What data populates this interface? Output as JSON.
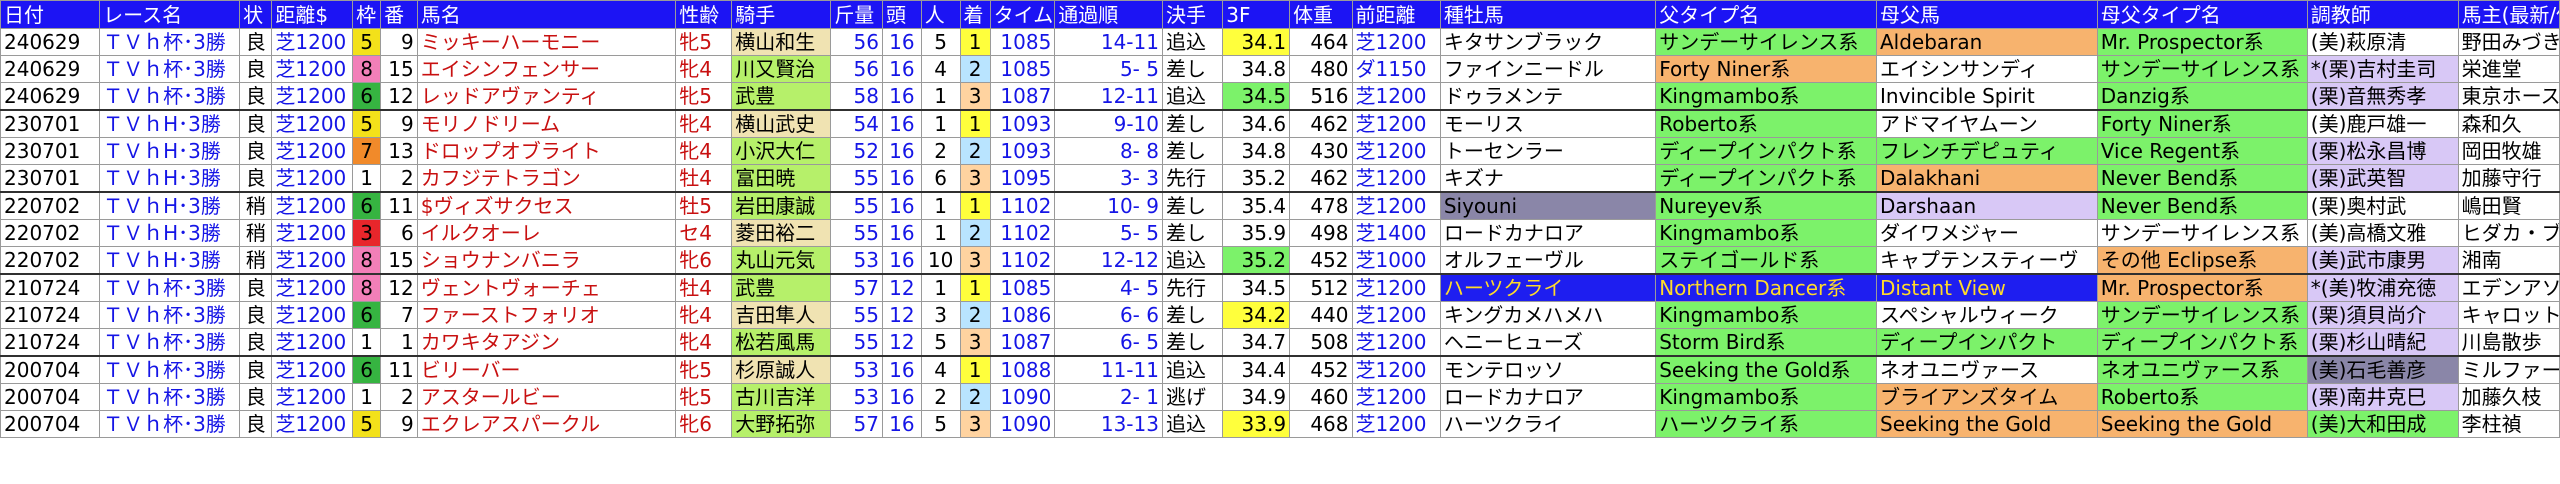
{
  "columns": [
    "日付",
    "レース名",
    "状",
    "距離$",
    "枠",
    "番",
    "馬名",
    "性齢",
    "騎手",
    "斤量",
    "頭",
    "人",
    "着",
    "タイム",
    "通過順",
    "決手",
    "3F",
    "体重",
    "前距離",
    "種牡馬",
    "父タイプ名",
    "母父馬",
    "母父タイプ名",
    "調教師",
    "馬主(最新/仮"
  ],
  "colors": {
    "header_bg": "#1c14f4",
    "frame1": "#ffffff",
    "frame2": "#222222",
    "frame3": "#e8262b",
    "frame4": "#2c62d6",
    "frame5": "#f3e11a",
    "frame6": "#36b441",
    "frame7": "#f18a2a",
    "frame8": "#f27fb8",
    "fast3f": "#ffff3c",
    "lime": "#7cf26a",
    "purple": "#d8c8f6",
    "jockey_green": "#b6f06a",
    "jockey_tan": "#f0e3b2",
    "orange": "#f7b36e",
    "navy": "#1e1ef0"
  },
  "rows": [
    {
      "date": "240629",
      "race": "ＴＶｈ杯･3勝",
      "cond": "良",
      "dist": "芝1200",
      "frame": "5",
      "no": "9",
      "horse": "ミッキーハーモニー",
      "sex": "牝5",
      "jockey": "横山和生",
      "kin": "56",
      "heads": "16",
      "pop": "5",
      "place": "1",
      "time": "1085",
      "pass": "14-11",
      "kimete": "追込",
      "f3": "34.1",
      "weight": "464",
      "prev": "芝1200",
      "sire": "キタサンブラック",
      "ftype": "サンデーサイレンス系",
      "damsire": "Aldebaran",
      "dstype": "Mr. Prospector系",
      "trainer": "(美)萩原清",
      "owner": "野田みづき",
      "bg": {
        "jockey": "#f0e3b2",
        "f3": "#ffff3c",
        "sire": "#ffffff",
        "ftype": "#7cf26a",
        "damsire": "#f7b36e",
        "dstype": "#7cf26a",
        "trainer": "#ffffff"
      }
    },
    {
      "date": "240629",
      "race": "ＴＶｈ杯･3勝",
      "cond": "良",
      "dist": "芝1200",
      "frame": "8",
      "no": "15",
      "horse": "エイシンフェンサー",
      "sex": "牝4",
      "jockey": "川又賢治",
      "kin": "56",
      "heads": "16",
      "pop": "4",
      "place": "2",
      "time": "1085",
      "pass": "5- 5",
      "kimete": "差し",
      "f3": "34.8",
      "weight": "480",
      "prev": "ダ1150",
      "sire": "ファインニードル",
      "ftype": "Forty Niner系",
      "damsire": "エイシンサンディ",
      "dstype": "サンデーサイレンス系",
      "trainer": "*(栗)吉村圭司",
      "owner": "栄進堂",
      "bg": {
        "jockey": "#b6f06a",
        "f3": "#ffffff",
        "sire": "#ffffff",
        "ftype": "#f7b36e",
        "damsire": "#ffffff",
        "dstype": "#7cf26a",
        "trainer": "#d8c8f6"
      }
    },
    {
      "date": "240629",
      "race": "ＴＶｈ杯･3勝",
      "cond": "良",
      "dist": "芝1200",
      "frame": "6",
      "no": "12",
      "horse": "レッドアヴァンティ",
      "sex": "牝5",
      "jockey": "武豊",
      "kin": "58",
      "heads": "16",
      "pop": "1",
      "place": "3",
      "time": "1087",
      "pass": "12-11",
      "kimete": "追込",
      "f3": "34.5",
      "weight": "516",
      "prev": "芝1200",
      "sire": "ドゥラメンテ",
      "ftype": "Kingmambo系",
      "damsire": "Invincible Spirit",
      "dstype": "Danzig系",
      "trainer": "(栗)音無秀孝",
      "owner": "東京ホースレー",
      "bg": {
        "jockey": "#b6f06a",
        "f3": "#7cf26a",
        "sire": "#ffffff",
        "ftype": "#7cf26a",
        "damsire": "#ffffff",
        "dstype": "#7cf26a",
        "trainer": "#d8c8f6"
      }
    },
    {
      "date": "230701",
      "race": "ＴＶｈH･3勝",
      "cond": "良",
      "dist": "芝1200",
      "frame": "5",
      "no": "9",
      "horse": "モリノドリーム",
      "sex": "牝4",
      "jockey": "横山武史",
      "kin": "54",
      "heads": "16",
      "pop": "1",
      "place": "1",
      "time": "1093",
      "pass": "9-10",
      "kimete": "差し",
      "f3": "34.6",
      "weight": "462",
      "prev": "芝1200",
      "sire": "モーリス",
      "ftype": "Roberto系",
      "damsire": "アドマイヤムーン",
      "dstype": "Forty Niner系",
      "trainer": "(美)鹿戸雄一",
      "owner": "森和久",
      "bg": {
        "jockey": "#f0e3b2",
        "f3": "#ffffff",
        "sire": "#ffffff",
        "ftype": "#7cf26a",
        "damsire": "#ffffff",
        "dstype": "#7cf26a",
        "trainer": "#ffffff"
      }
    },
    {
      "date": "230701",
      "race": "ＴＶｈH･3勝",
      "cond": "良",
      "dist": "芝1200",
      "frame": "7",
      "no": "13",
      "horse": "ドロップオブライト",
      "sex": "牝4",
      "jockey": "小沢大仁",
      "kin": "52",
      "heads": "16",
      "pop": "2",
      "place": "2",
      "time": "1093",
      "pass": "8- 8",
      "kimete": "差し",
      "f3": "34.8",
      "weight": "430",
      "prev": "芝1200",
      "sire": "トーセンラー",
      "ftype": "ディープインパクト系",
      "damsire": "フレンチデピュティ",
      "dstype": "Vice Regent系",
      "trainer": "(栗)松永昌博",
      "owner": "岡田牧雄",
      "bg": {
        "jockey": "#b6f06a",
        "f3": "#ffffff",
        "sire": "#ffffff",
        "ftype": "#7cf26a",
        "damsire": "#7cf26a",
        "dstype": "#7cf26a",
        "trainer": "#d8c8f6"
      }
    },
    {
      "date": "230701",
      "race": "ＴＶｈH･3勝",
      "cond": "良",
      "dist": "芝1200",
      "frame": "1",
      "no": "2",
      "horse": "カフジテトラゴン",
      "sex": "牡4",
      "jockey": "富田暁",
      "kin": "55",
      "heads": "16",
      "pop": "6",
      "place": "3",
      "time": "1095",
      "pass": "3- 3",
      "kimete": "先行",
      "f3": "35.2",
      "weight": "462",
      "prev": "芝1200",
      "sire": "キズナ",
      "ftype": "ディープインパクト系",
      "damsire": "Dalakhani",
      "dstype": "Never Bend系",
      "trainer": "(栗)武英智",
      "owner": "加藤守行",
      "bg": {
        "jockey": "#b6f06a",
        "f3": "#ffffff",
        "sire": "#ffffff",
        "ftype": "#7cf26a",
        "damsire": "#f7b36e",
        "dstype": "#7cf26a",
        "trainer": "#d8c8f6"
      }
    },
    {
      "date": "220702",
      "race": "ＴＶｈH･3勝",
      "cond": "稍",
      "dist": "芝1200",
      "frame": "6",
      "no": "11",
      "horse": "$ヴィズサクセス",
      "sex": "牡5",
      "jockey": "岩田康誠",
      "kin": "55",
      "heads": "16",
      "pop": "1",
      "place": "1",
      "time": "1102",
      "pass": "10- 9",
      "kimete": "差し",
      "f3": "35.4",
      "weight": "478",
      "prev": "芝1200",
      "sire": "Siyouni",
      "ftype": "Nureyev系",
      "damsire": "Darshaan",
      "dstype": "Never Bend系",
      "trainer": "(栗)奥村武",
      "owner": "嶋田賢",
      "bg": {
        "jockey": "#b6f06a",
        "f3": "#ffffff",
        "sire": "#8a86a8",
        "ftype": "#7cf26a",
        "damsire": "#d8c8f6",
        "dstype": "#7cf26a",
        "trainer": "#ffffff"
      }
    },
    {
      "date": "220702",
      "race": "ＴＶｈH･3勝",
      "cond": "稍",
      "dist": "芝1200",
      "frame": "3",
      "no": "6",
      "horse": "イルクオーレ",
      "sex": "セ4",
      "jockey": "菱田裕二",
      "kin": "55",
      "heads": "16",
      "pop": "1",
      "place": "2",
      "time": "1102",
      "pass": "5- 5",
      "kimete": "差し",
      "f3": "35.9",
      "weight": "498",
      "prev": "芝1400",
      "sire": "ロードカナロア",
      "ftype": "Kingmambo系",
      "damsire": "ダイワメジャー",
      "dstype": "サンデーサイレンス系",
      "trainer": "(美)高橋文雅",
      "owner": "ヒダカ・ブリーダー",
      "bg": {
        "jockey": "#f0e3b2",
        "f3": "#ffffff",
        "sire": "#ffffff",
        "ftype": "#7cf26a",
        "damsire": "#ffffff",
        "dstype": "#ffffff",
        "trainer": "#ffffff"
      }
    },
    {
      "date": "220702",
      "race": "ＴＶｈH･3勝",
      "cond": "稍",
      "dist": "芝1200",
      "frame": "8",
      "no": "15",
      "horse": "ショウナンバニラ",
      "sex": "牝6",
      "jockey": "丸山元気",
      "kin": "53",
      "heads": "16",
      "pop": "10",
      "place": "3",
      "time": "1102",
      "pass": "12-12",
      "kimete": "追込",
      "f3": "35.2",
      "weight": "452",
      "prev": "芝1000",
      "sire": "オルフェーヴル",
      "ftype": "ステイゴールド系",
      "damsire": "キャプテンスティーヴ",
      "dstype": "その他 Eclipse系",
      "trainer": "(美)武市康男",
      "owner": "湘南",
      "bg": {
        "jockey": "#b6f06a",
        "f3": "#7cf26a",
        "sire": "#ffffff",
        "ftype": "#7cf26a",
        "damsire": "#ffffff",
        "dstype": "#f7b36e",
        "trainer": "#d8c8f6"
      }
    },
    {
      "date": "210724",
      "race": "ＴＶｈ杯･3勝",
      "cond": "良",
      "dist": "芝1200",
      "frame": "8",
      "no": "12",
      "horse": "ヴェントヴォーチェ",
      "sex": "牡4",
      "jockey": "武豊",
      "kin": "57",
      "heads": "12",
      "pop": "1",
      "place": "1",
      "time": "1085",
      "pass": "4- 5",
      "kimete": "先行",
      "f3": "34.5",
      "weight": "512",
      "prev": "芝1200",
      "sire": "ハーツクライ",
      "ftype": "Northern Dancer系",
      "damsire": "Distant View",
      "dstype": "Mr. Prospector系",
      "trainer": "*(美)牧浦充徳",
      "owner": "エデンアソシエ",
      "bg": {
        "jockey": "#b6f06a",
        "f3": "#ffffff",
        "sire": "#1e1ef0",
        "ftype": "#1e1ef0",
        "damsire": "#1e1ef0",
        "dstype": "#f7b36e",
        "trainer": "#d8c8f6"
      }
    },
    {
      "date": "210724",
      "race": "ＴＶｈ杯･3勝",
      "cond": "良",
      "dist": "芝1200",
      "frame": "6",
      "no": "7",
      "horse": "ファーストフォリオ",
      "sex": "牝4",
      "jockey": "吉田隼人",
      "kin": "55",
      "heads": "12",
      "pop": "3",
      "place": "2",
      "time": "1086",
      "pass": "6- 6",
      "kimete": "差し",
      "f3": "34.2",
      "weight": "440",
      "prev": "芝1200",
      "sire": "キングカメハメハ",
      "ftype": "Kingmambo系",
      "damsire": "スペシャルウィーク",
      "dstype": "サンデーサイレンス系",
      "trainer": "(栗)須貝尚介",
      "owner": "キャロットファー",
      "bg": {
        "jockey": "#f0e3b2",
        "f3": "#ffff3c",
        "sire": "#ffffff",
        "ftype": "#7cf26a",
        "damsire": "#ffffff",
        "dstype": "#7cf26a",
        "trainer": "#d8c8f6"
      }
    },
    {
      "date": "210724",
      "race": "ＴＶｈ杯･3勝",
      "cond": "良",
      "dist": "芝1200",
      "frame": "1",
      "no": "1",
      "horse": "カワキタアジン",
      "sex": "牝4",
      "jockey": "松若風馬",
      "kin": "55",
      "heads": "12",
      "pop": "5",
      "place": "3",
      "time": "1087",
      "pass": "6- 5",
      "kimete": "差し",
      "f3": "34.7",
      "weight": "508",
      "prev": "芝1200",
      "sire": "ヘニーヒューズ",
      "ftype": "Storm Bird系",
      "damsire": "ディープインパクト",
      "dstype": "ディープインパクト系",
      "trainer": "(栗)杉山晴紀",
      "owner": "川島散歩",
      "bg": {
        "jockey": "#b6f06a",
        "f3": "#ffffff",
        "sire": "#ffffff",
        "ftype": "#7cf26a",
        "damsire": "#7cf26a",
        "dstype": "#7cf26a",
        "trainer": "#d8c8f6"
      }
    },
    {
      "date": "200704",
      "race": "ＴＶｈ杯･3勝",
      "cond": "良",
      "dist": "芝1200",
      "frame": "6",
      "no": "11",
      "horse": "ビリーバー",
      "sex": "牝5",
      "jockey": "杉原誠人",
      "kin": "53",
      "heads": "16",
      "pop": "4",
      "place": "1",
      "time": "1088",
      "pass": "11-11",
      "kimete": "追込",
      "f3": "34.4",
      "weight": "452",
      "prev": "芝1200",
      "sire": "モンテロッソ",
      "ftype": "Seeking the Gold系",
      "damsire": "ネオユニヴァース",
      "dstype": "ネオユニヴァース系",
      "trainer": "(美)石毛善彦",
      "owner": "ミルファーム",
      "bg": {
        "jockey": "#f0e3b2",
        "f3": "#ffffff",
        "sire": "#ffffff",
        "ftype": "#7cf26a",
        "damsire": "#ffffff",
        "dstype": "#7cf26a",
        "trainer": "#8a86a8"
      }
    },
    {
      "date": "200704",
      "race": "ＴＶｈ杯･3勝",
      "cond": "良",
      "dist": "芝1200",
      "frame": "1",
      "no": "2",
      "horse": "アスタールビー",
      "sex": "牝5",
      "jockey": "古川吉洋",
      "kin": "53",
      "heads": "16",
      "pop": "2",
      "place": "2",
      "time": "1090",
      "pass": "2- 1",
      "kimete": "逃げ",
      "f3": "34.9",
      "weight": "460",
      "prev": "芝1200",
      "sire": "ロードカナロア",
      "ftype": "Kingmambo系",
      "damsire": "ブライアンズタイム",
      "dstype": "Roberto系",
      "trainer": "(栗)南井克巳",
      "owner": "加藤久枝",
      "bg": {
        "jockey": "#b6f06a",
        "f3": "#ffffff",
        "sire": "#ffffff",
        "ftype": "#7cf26a",
        "damsire": "#f7b36e",
        "dstype": "#7cf26a",
        "trainer": "#d8c8f6"
      }
    },
    {
      "date": "200704",
      "race": "ＴＶｈ杯･3勝",
      "cond": "良",
      "dist": "芝1200",
      "frame": "5",
      "no": "9",
      "horse": "エクレアスパークル",
      "sex": "牝6",
      "jockey": "大野拓弥",
      "kin": "57",
      "heads": "16",
      "pop": "5",
      "place": "3",
      "time": "1090",
      "pass": "13-13",
      "kimete": "追込",
      "f3": "33.9",
      "weight": "468",
      "prev": "芝1200",
      "sire": "ハーツクライ",
      "ftype": "ハーツクライ系",
      "damsire": "Seeking the Gold",
      "dstype": "Seeking the Gold",
      "trainer": "(美)大和田成",
      "owner": "李柱禎",
      "bg": {
        "jockey": "#b6f06a",
        "f3": "#ffff3c",
        "sire": "#ffffff",
        "ftype": "#7cf26a",
        "damsire": "#f7b36e",
        "dstype": "#f7b36e",
        "trainer": "#7cf26a"
      }
    }
  ]
}
